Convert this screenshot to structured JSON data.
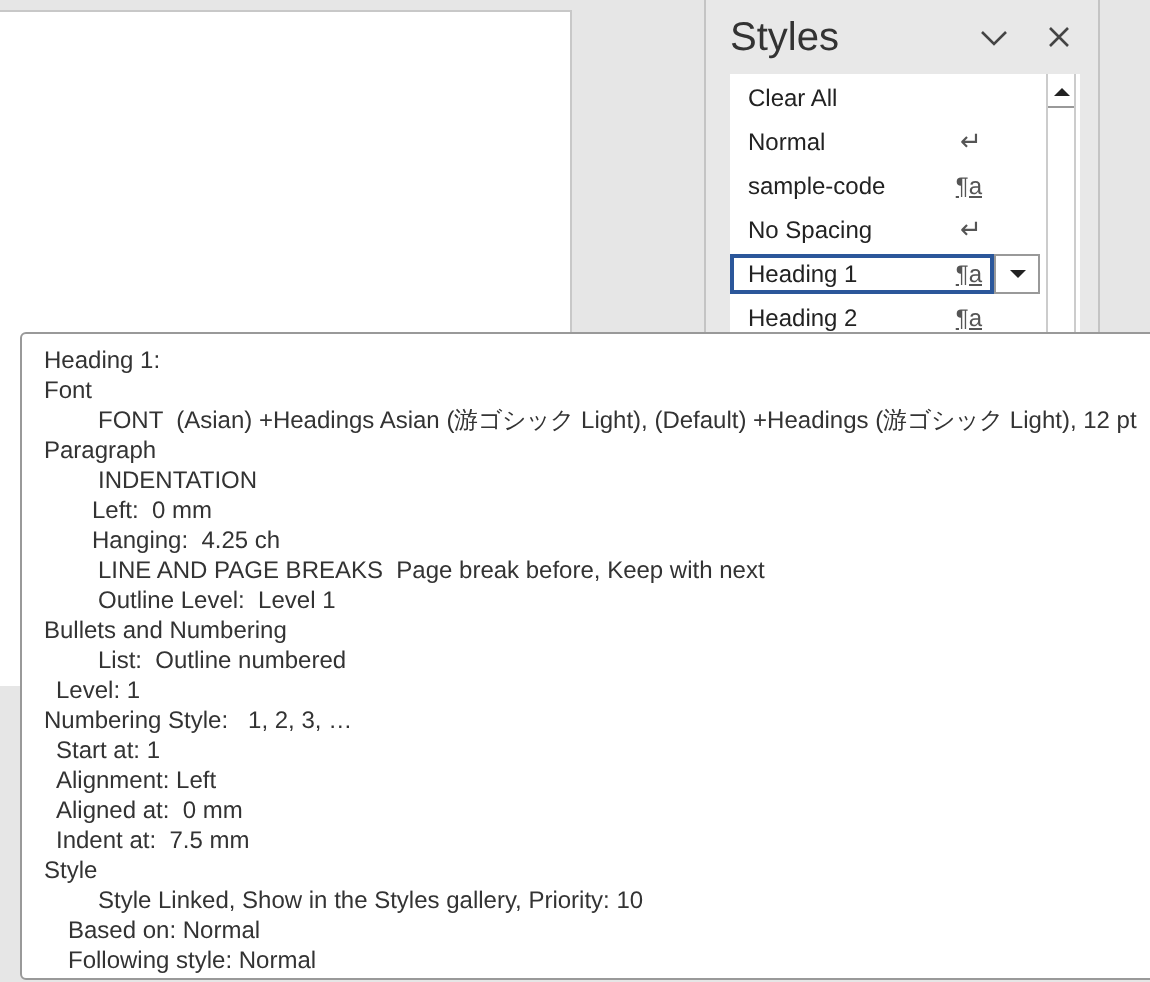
{
  "styles_pane": {
    "title": "Styles",
    "items": [
      {
        "label": "Clear All",
        "kind": "plain",
        "selected": false
      },
      {
        "label": "Normal",
        "symbol": "↵",
        "kind": "paragraph",
        "selected": false
      },
      {
        "label": "sample-code",
        "symbol": "¶a",
        "kind": "linked",
        "selected": false
      },
      {
        "label": "No Spacing",
        "symbol": "↵",
        "kind": "paragraph",
        "selected": false
      },
      {
        "label": "Heading 1",
        "symbol": "¶a",
        "kind": "linked",
        "selected": true
      },
      {
        "label": "Heading 2",
        "symbol": "¶a",
        "kind": "linked",
        "selected": false
      }
    ]
  },
  "tooltip": {
    "lines": [
      {
        "text": "Heading 1:",
        "kind": "section"
      },
      {
        "text": "Font",
        "kind": "section"
      },
      {
        "text": "FONT  (Asian) +Headings Asian (游ゴシック Light), (Default) +Headings (游ゴシック Light), 12 pt",
        "kind": "item"
      },
      {
        "text": "Paragraph",
        "kind": "section"
      },
      {
        "text": "INDENTATION",
        "kind": "item"
      },
      {
        "text": "Left:  0 mm",
        "kind": "value"
      },
      {
        "text": "Hanging:  4.25 ch",
        "kind": "value"
      },
      {
        "text": "LINE AND PAGE BREAKS  Page break before, Keep with next",
        "kind": "item"
      },
      {
        "text": "Outline Level:  Level 1",
        "kind": "item"
      },
      {
        "text": "Bullets and Numbering",
        "kind": "section"
      },
      {
        "text": "List:  Outline numbered",
        "kind": "item"
      },
      {
        "text": "Level: 1",
        "kind": "field"
      },
      {
        "text": "Numbering Style:   1, 2, 3, …",
        "kind": "section"
      },
      {
        "text": "Start at: 1",
        "kind": "field"
      },
      {
        "text": "Alignment: Left",
        "kind": "field"
      },
      {
        "text": "Aligned at:  0 mm",
        "kind": "field"
      },
      {
        "text": "Indent at:  7.5 mm",
        "kind": "field"
      },
      {
        "text": "Style",
        "kind": "section"
      },
      {
        "text": "Style Linked, Show in the Styles gallery, Priority: 10",
        "kind": "item"
      },
      {
        "text": "Based on: Normal",
        "kind": "property"
      },
      {
        "text": "Following style: Normal",
        "kind": "property"
      }
    ]
  }
}
